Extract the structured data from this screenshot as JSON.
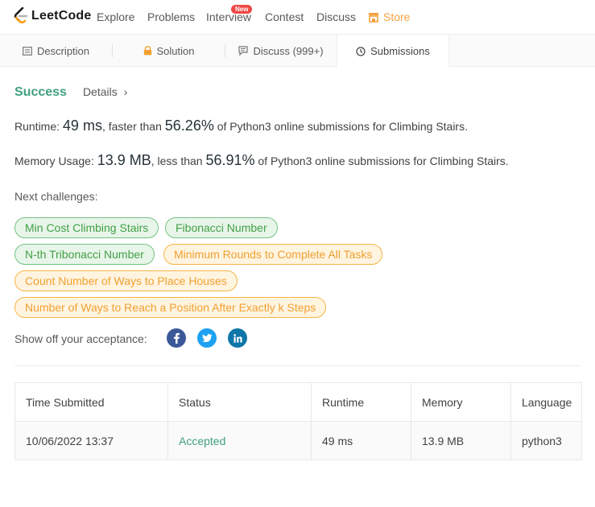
{
  "nav": {
    "logo_text": "LeetCode",
    "items": [
      "Explore",
      "Problems",
      "Interview",
      "Contest",
      "Discuss"
    ],
    "new_badge": "New",
    "store": "Store"
  },
  "tabs": [
    {
      "label": "Description",
      "icon": "description-icon"
    },
    {
      "label": "Solution",
      "icon": "lock-icon"
    },
    {
      "label": "Discuss (999+)",
      "icon": "chat-icon"
    },
    {
      "label": "Submissions",
      "icon": "clock-icon",
      "active": true
    }
  ],
  "result": {
    "status": "Success",
    "details": "Details",
    "chevron": "›",
    "runtime": {
      "label": "Runtime:",
      "value": "49 ms",
      "comparison": ", faster than",
      "percent": "56.26%",
      "suffix": "of Python3 online submissions for Climbing Stairs."
    },
    "memory": {
      "label": "Memory Usage:",
      "value": "13.9 MB",
      "comparison": ", less than",
      "percent": "56.91%",
      "suffix": "of Python3 online submissions for Climbing Stairs."
    }
  },
  "next_challenges": {
    "label": "Next challenges:",
    "items": [
      {
        "title": "Min Cost Climbing Stairs",
        "difficulty": "easy"
      },
      {
        "title": "Fibonacci Number",
        "difficulty": "easy"
      },
      {
        "title": "N-th Tribonacci Number",
        "difficulty": "easy"
      },
      {
        "title": "Minimum Rounds to Complete All Tasks",
        "difficulty": "medium"
      },
      {
        "title": "Count Number of Ways to Place Houses",
        "difficulty": "medium"
      },
      {
        "title": "Number of Ways to Reach a Position After Exactly k Steps",
        "difficulty": "medium"
      }
    ]
  },
  "share": {
    "label": "Show off your acceptance:",
    "networks": [
      "facebook-icon",
      "twitter-icon",
      "linkedin-icon"
    ]
  },
  "colors": {
    "success": "#409f82",
    "easy": "#43a047",
    "medium": "#f0a030",
    "store": "#f4a13f",
    "facebook": "#3b5998",
    "twitter": "#1da1f2",
    "linkedin": "#0e76a8"
  },
  "submissions": {
    "headers": [
      "Time Submitted",
      "Status",
      "Runtime",
      "Memory",
      "Language"
    ],
    "rows": [
      [
        "10/06/2022 13:37",
        "Accepted",
        "49 ms",
        "13.9 MB",
        "python3"
      ]
    ]
  }
}
